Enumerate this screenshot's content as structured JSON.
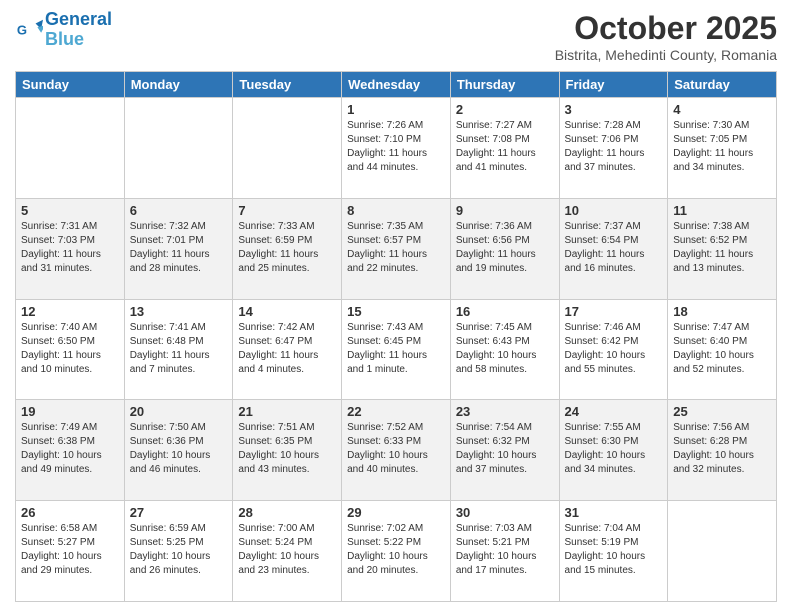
{
  "header": {
    "logo_line1": "General",
    "logo_line2": "Blue",
    "month": "October 2025",
    "location": "Bistrita, Mehedinti County, Romania"
  },
  "weekdays": [
    "Sunday",
    "Monday",
    "Tuesday",
    "Wednesday",
    "Thursday",
    "Friday",
    "Saturday"
  ],
  "weeks": [
    [
      {
        "day": "",
        "info": ""
      },
      {
        "day": "",
        "info": ""
      },
      {
        "day": "",
        "info": ""
      },
      {
        "day": "1",
        "info": "Sunrise: 7:26 AM\nSunset: 7:10 PM\nDaylight: 11 hours and 44 minutes."
      },
      {
        "day": "2",
        "info": "Sunrise: 7:27 AM\nSunset: 7:08 PM\nDaylight: 11 hours and 41 minutes."
      },
      {
        "day": "3",
        "info": "Sunrise: 7:28 AM\nSunset: 7:06 PM\nDaylight: 11 hours and 37 minutes."
      },
      {
        "day": "4",
        "info": "Sunrise: 7:30 AM\nSunset: 7:05 PM\nDaylight: 11 hours and 34 minutes."
      }
    ],
    [
      {
        "day": "5",
        "info": "Sunrise: 7:31 AM\nSunset: 7:03 PM\nDaylight: 11 hours and 31 minutes."
      },
      {
        "day": "6",
        "info": "Sunrise: 7:32 AM\nSunset: 7:01 PM\nDaylight: 11 hours and 28 minutes."
      },
      {
        "day": "7",
        "info": "Sunrise: 7:33 AM\nSunset: 6:59 PM\nDaylight: 11 hours and 25 minutes."
      },
      {
        "day": "8",
        "info": "Sunrise: 7:35 AM\nSunset: 6:57 PM\nDaylight: 11 hours and 22 minutes."
      },
      {
        "day": "9",
        "info": "Sunrise: 7:36 AM\nSunset: 6:56 PM\nDaylight: 11 hours and 19 minutes."
      },
      {
        "day": "10",
        "info": "Sunrise: 7:37 AM\nSunset: 6:54 PM\nDaylight: 11 hours and 16 minutes."
      },
      {
        "day": "11",
        "info": "Sunrise: 7:38 AM\nSunset: 6:52 PM\nDaylight: 11 hours and 13 minutes."
      }
    ],
    [
      {
        "day": "12",
        "info": "Sunrise: 7:40 AM\nSunset: 6:50 PM\nDaylight: 11 hours and 10 minutes."
      },
      {
        "day": "13",
        "info": "Sunrise: 7:41 AM\nSunset: 6:48 PM\nDaylight: 11 hours and 7 minutes."
      },
      {
        "day": "14",
        "info": "Sunrise: 7:42 AM\nSunset: 6:47 PM\nDaylight: 11 hours and 4 minutes."
      },
      {
        "day": "15",
        "info": "Sunrise: 7:43 AM\nSunset: 6:45 PM\nDaylight: 11 hours and 1 minute."
      },
      {
        "day": "16",
        "info": "Sunrise: 7:45 AM\nSunset: 6:43 PM\nDaylight: 10 hours and 58 minutes."
      },
      {
        "day": "17",
        "info": "Sunrise: 7:46 AM\nSunset: 6:42 PM\nDaylight: 10 hours and 55 minutes."
      },
      {
        "day": "18",
        "info": "Sunrise: 7:47 AM\nSunset: 6:40 PM\nDaylight: 10 hours and 52 minutes."
      }
    ],
    [
      {
        "day": "19",
        "info": "Sunrise: 7:49 AM\nSunset: 6:38 PM\nDaylight: 10 hours and 49 minutes."
      },
      {
        "day": "20",
        "info": "Sunrise: 7:50 AM\nSunset: 6:36 PM\nDaylight: 10 hours and 46 minutes."
      },
      {
        "day": "21",
        "info": "Sunrise: 7:51 AM\nSunset: 6:35 PM\nDaylight: 10 hours and 43 minutes."
      },
      {
        "day": "22",
        "info": "Sunrise: 7:52 AM\nSunset: 6:33 PM\nDaylight: 10 hours and 40 minutes."
      },
      {
        "day": "23",
        "info": "Sunrise: 7:54 AM\nSunset: 6:32 PM\nDaylight: 10 hours and 37 minutes."
      },
      {
        "day": "24",
        "info": "Sunrise: 7:55 AM\nSunset: 6:30 PM\nDaylight: 10 hours and 34 minutes."
      },
      {
        "day": "25",
        "info": "Sunrise: 7:56 AM\nSunset: 6:28 PM\nDaylight: 10 hours and 32 minutes."
      }
    ],
    [
      {
        "day": "26",
        "info": "Sunrise: 6:58 AM\nSunset: 5:27 PM\nDaylight: 10 hours and 29 minutes."
      },
      {
        "day": "27",
        "info": "Sunrise: 6:59 AM\nSunset: 5:25 PM\nDaylight: 10 hours and 26 minutes."
      },
      {
        "day": "28",
        "info": "Sunrise: 7:00 AM\nSunset: 5:24 PM\nDaylight: 10 hours and 23 minutes."
      },
      {
        "day": "29",
        "info": "Sunrise: 7:02 AM\nSunset: 5:22 PM\nDaylight: 10 hours and 20 minutes."
      },
      {
        "day": "30",
        "info": "Sunrise: 7:03 AM\nSunset: 5:21 PM\nDaylight: 10 hours and 17 minutes."
      },
      {
        "day": "31",
        "info": "Sunrise: 7:04 AM\nSunset: 5:19 PM\nDaylight: 10 hours and 15 minutes."
      },
      {
        "day": "",
        "info": ""
      }
    ]
  ]
}
